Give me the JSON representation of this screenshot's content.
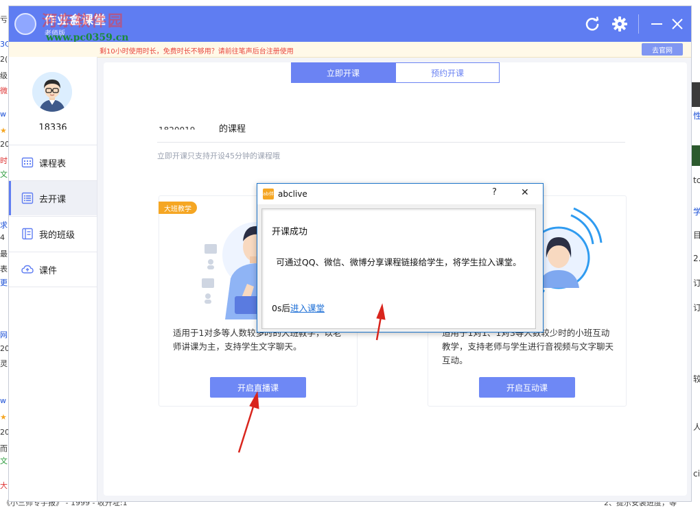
{
  "app": {
    "title": "作业盒课堂",
    "subtitle": "老师版"
  },
  "watermark": {
    "name": "河东软件园",
    "url": "www.pc0359.cn"
  },
  "notice": {
    "text": "剩10小时使用时长，免费时长不够用？请前往笔声后台注册使用",
    "button": "去官网"
  },
  "titlebar_icons": [
    "refresh-icon",
    "gear-icon",
    "minimize-icon",
    "close-icon"
  ],
  "user": {
    "id": "18336"
  },
  "sidebar": {
    "items": [
      {
        "label": "课程表",
        "icon": "calendar-icon"
      },
      {
        "label": "去开课",
        "icon": "list-icon"
      },
      {
        "label": "我的班级",
        "icon": "class-icon"
      },
      {
        "label": "课件",
        "icon": "cloud-icon"
      }
    ]
  },
  "tabs": {
    "now": "立即开课",
    "scheduled": "预约开课"
  },
  "course": {
    "uid": "1820019",
    "heading": "的课程",
    "hint": "立即开课只支持开设45分钟的课程哦"
  },
  "cards": {
    "left": {
      "tag": "大班教学",
      "desc": "适用于1对多等人数较多时的大班教学，以老师讲课为主，支持学生文字聊天。",
      "button": "开启直播课"
    },
    "right": {
      "desc": "适用于1对1、1对3等人数较少时的小班互动教学，支持老师与学生进行音视频与文字聊天互动。",
      "button": "开启互动课"
    }
  },
  "dialog": {
    "title": "abclive",
    "logo": "ab伴",
    "help": "?",
    "close": "✕",
    "heading": "开课成功",
    "message": "可通过QQ、微信、微博分享课程链接给学生，将学生拉入课堂。",
    "countdown": "0s后",
    "link": "进入课堂"
  },
  "bottom_text": "《小三师专手报》 - 1999 - 收升址:1",
  "colors": {
    "primary": "#5f7df2",
    "button": "#6e88f5",
    "tag": "#f5a623",
    "notice_text": "#e8453c",
    "arrow": "#d9251d"
  }
}
